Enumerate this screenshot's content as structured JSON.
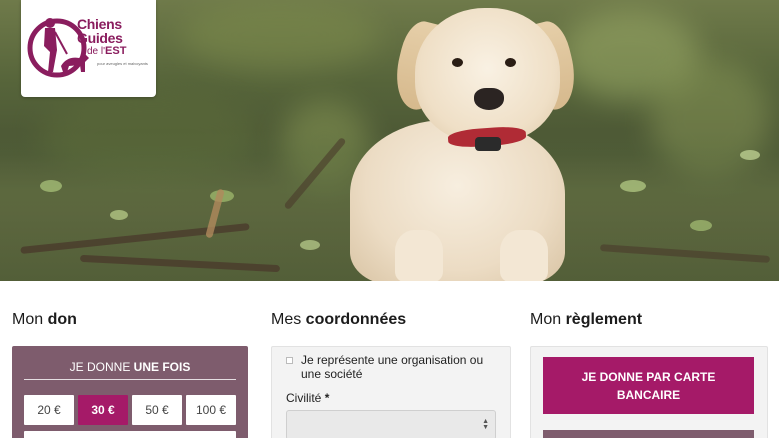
{
  "logo": {
    "line1": "Chiens",
    "line2": "Guides",
    "line3_prefix": "de l'",
    "line3_bold": "EST",
    "tagline": "pour aveugles et malvoyants",
    "brand_color": "#8a1d5e"
  },
  "hero": {
    "image": "labrador-puppy-photo"
  },
  "don": {
    "title_regular": "Mon ",
    "title_bold": "don",
    "head_regular": "JE DONNE ",
    "head_bold": "UNE FOIS",
    "amounts": [
      "20 €",
      "30 €",
      "50 €",
      "100 €"
    ],
    "selected": "30 €"
  },
  "coordonnees": {
    "title_regular": "Mes ",
    "title_bold": "coordonnées",
    "org_checkbox_label": "Je représente une organisation ou une société",
    "civilite_label": "Civilité",
    "required_mark": "*"
  },
  "reglement": {
    "title_regular": "Mon ",
    "title_bold": "règlement",
    "card_button": "JE DONNE PAR CARTE BANCAIRE"
  },
  "colors": {
    "accent": "#a51a68",
    "panel_mauve": "#7e5c6d"
  }
}
